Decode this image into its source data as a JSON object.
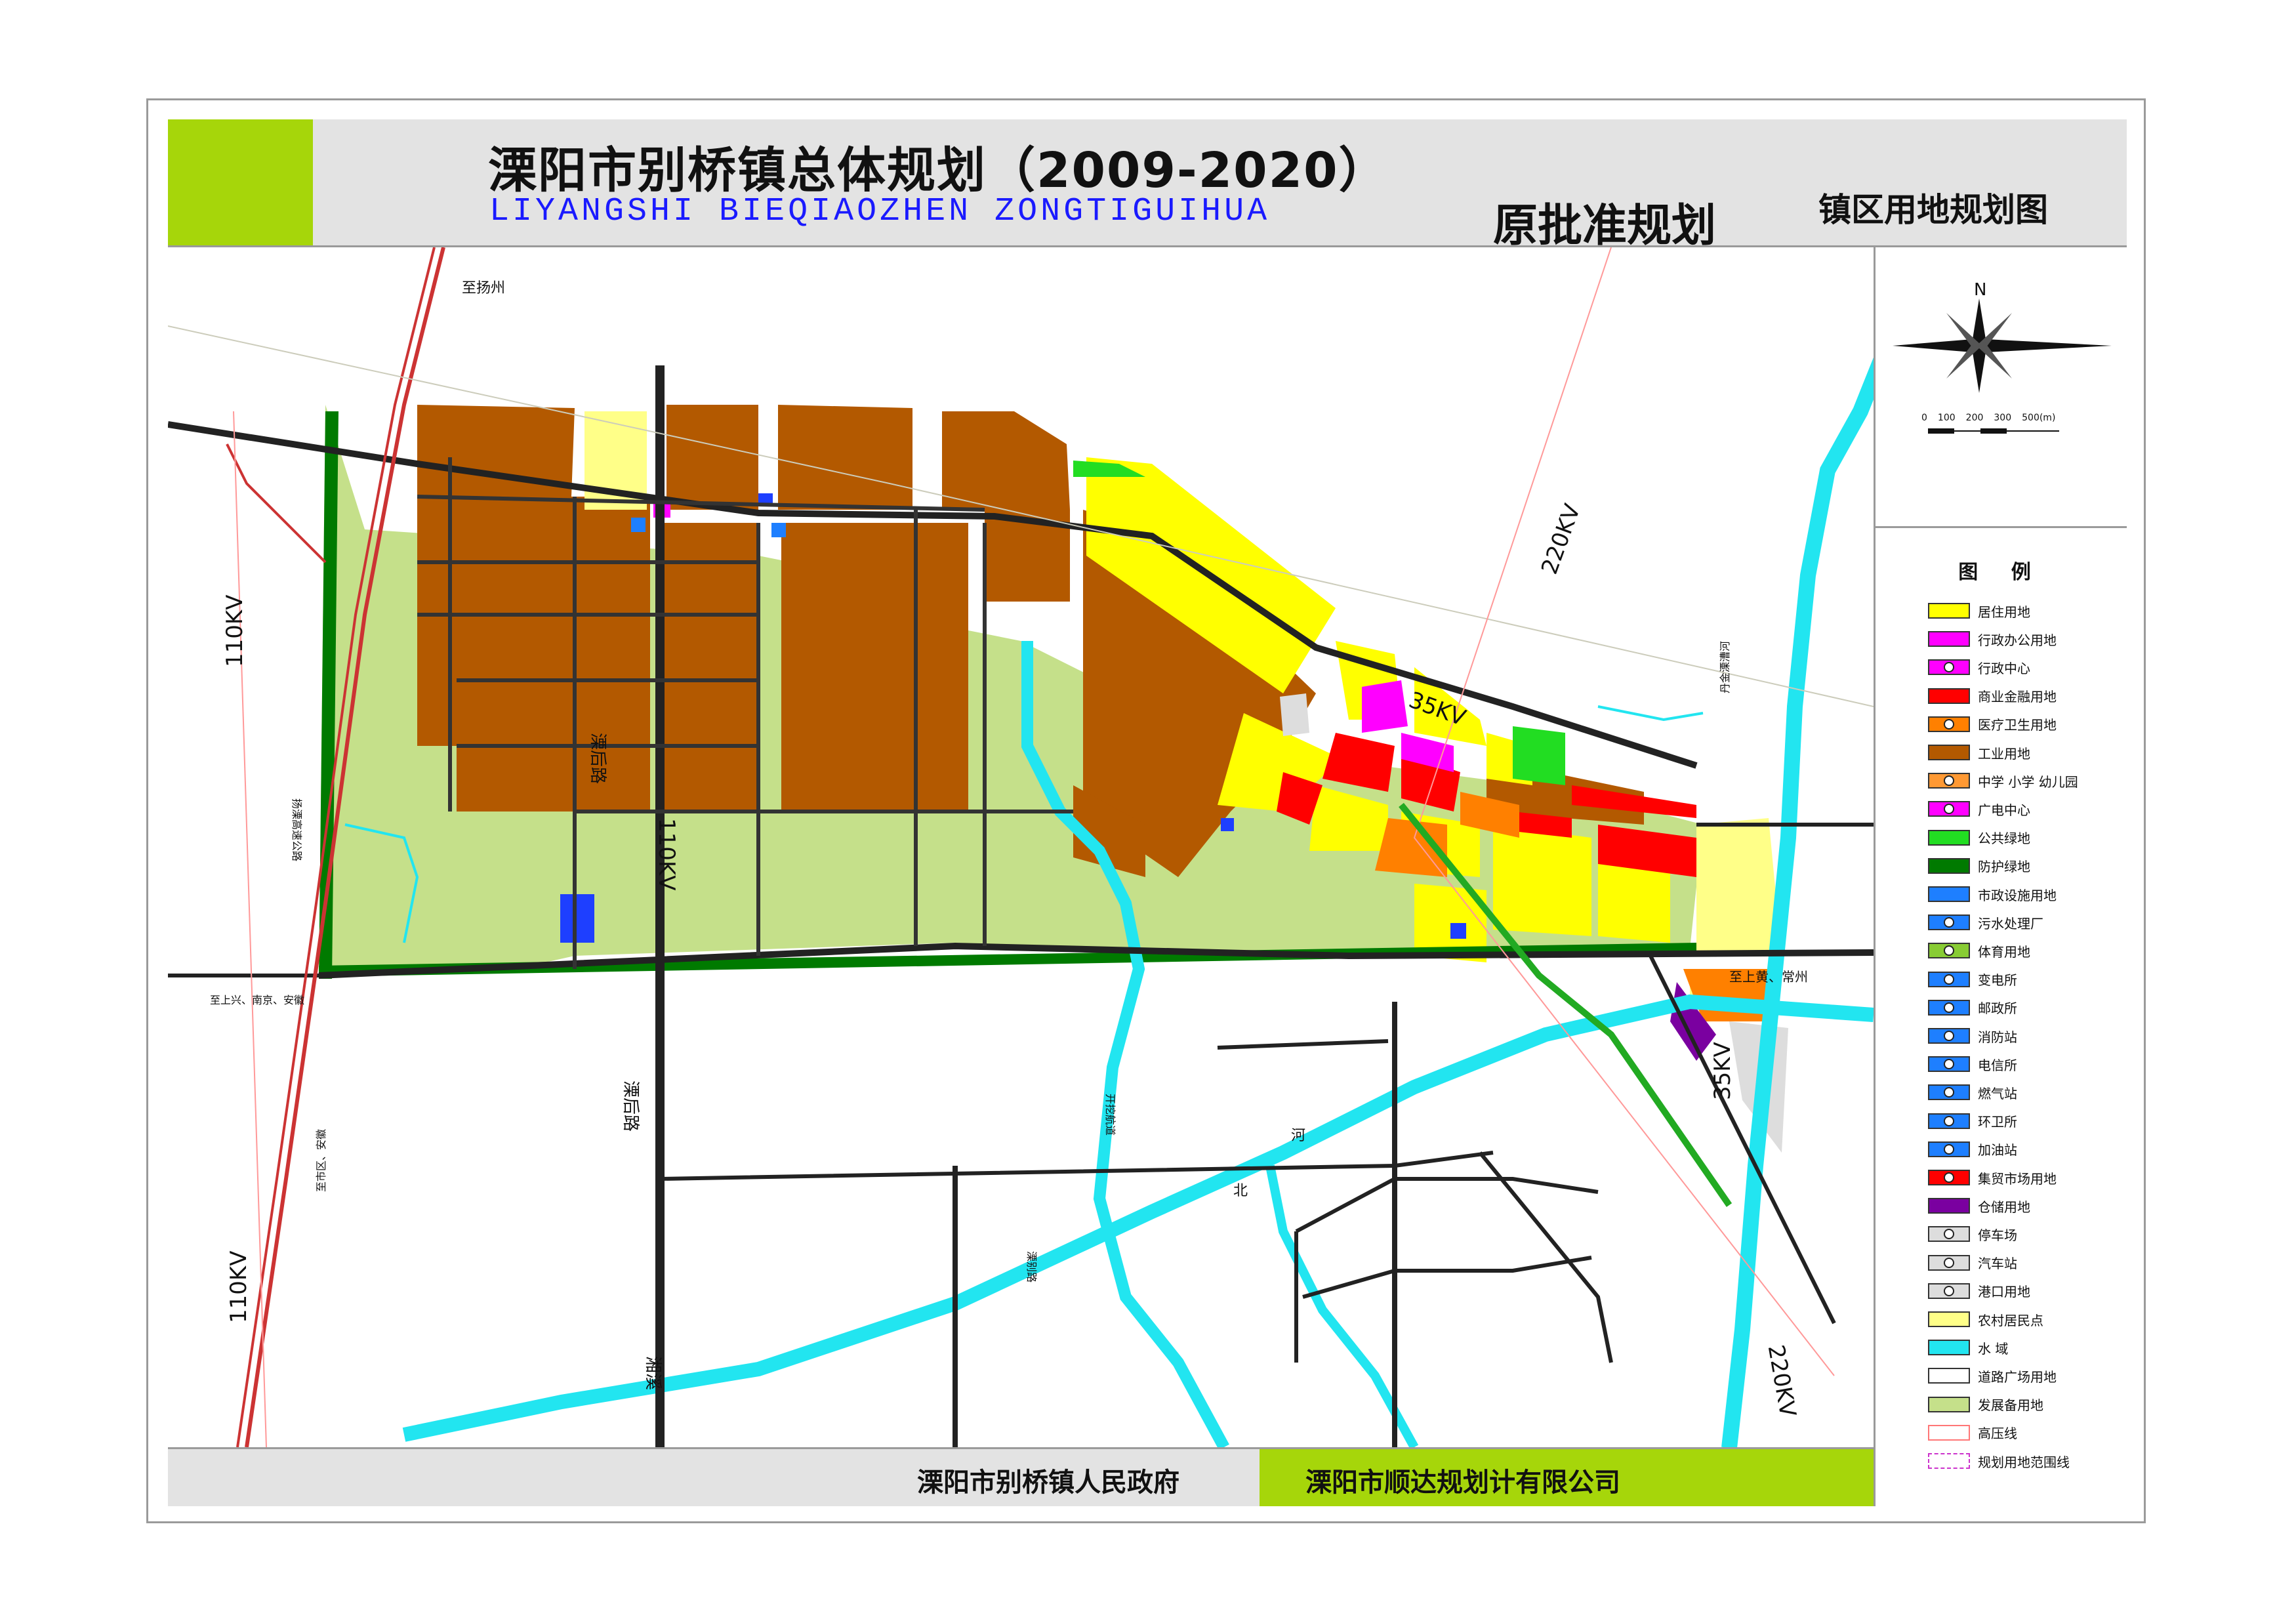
{
  "header": {
    "title": "溧阳市别桥镇总体规划（2009-2020）",
    "pinyin": "LIYANGSHI BIEQIAOZHEN ZONGTIGUIHUA",
    "original_plan": "原批准规划",
    "sheet_name": "镇区用地规划图"
  },
  "compass": {
    "north": "N",
    "scale_labels": [
      "0",
      "100",
      "200",
      "300",
      "500(m)"
    ]
  },
  "legend": {
    "title": "图 例",
    "items": [
      {
        "label": "居住用地",
        "color": "#ffff00"
      },
      {
        "label": "行政办公用地",
        "color": "#ff00ff"
      },
      {
        "label": "行政中心",
        "color": "#ff00ff"
      },
      {
        "label": "商业金融用地",
        "color": "#ff0000"
      },
      {
        "label": "医疗卫生用地",
        "color": "#ff8000"
      },
      {
        "label": "工业用地",
        "color": "#b35900"
      },
      {
        "label": "中学 小学 幼儿园",
        "color": "#ff9933"
      },
      {
        "label": "广电中心",
        "color": "#ff00ff"
      },
      {
        "label": "公共绿地",
        "color": "#22dd22"
      },
      {
        "label": "防护绿地",
        "color": "#007a00"
      },
      {
        "label": "市政设施用地",
        "color": "#1e7fff"
      },
      {
        "label": "污水处理厂",
        "color": "#1e7fff"
      },
      {
        "label": "体育用地",
        "color": "#88cc33"
      },
      {
        "label": "变电所",
        "color": "#1e7fff"
      },
      {
        "label": "邮政所",
        "color": "#1e7fff"
      },
      {
        "label": "消防站",
        "color": "#1e7fff"
      },
      {
        "label": "电信所",
        "color": "#1e7fff"
      },
      {
        "label": "燃气站",
        "color": "#1e7fff"
      },
      {
        "label": "环卫所",
        "color": "#1e7fff"
      },
      {
        "label": "加油站",
        "color": "#1e7fff"
      },
      {
        "label": "集贸市场用地",
        "color": "#ff0000"
      },
      {
        "label": "仓储用地",
        "color": "#7a00a0"
      },
      {
        "label": "停车场",
        "color": "#dddddd"
      },
      {
        "label": "汽车站",
        "color": "#dddddd"
      },
      {
        "label": "港口用地",
        "color": "#dddddd"
      },
      {
        "label": "农村居民点",
        "color": "#ffff88"
      },
      {
        "label": "水 域",
        "color": "#22e5f0"
      },
      {
        "label": "道路广场用地",
        "color": "#ffffff"
      },
      {
        "label": "发展备用地",
        "color": "#c5e08a"
      },
      {
        "label": "高压线",
        "color": "#ff7777"
      },
      {
        "label": "规划用地范围线",
        "color": "#cc33cc"
      }
    ]
  },
  "map_labels": {
    "to_yangzhou": "至扬州",
    "to_shangxing": "至上兴、南京、安徽",
    "to_shanghuang": "至上黄、常州",
    "to_liyang": "至市区、安徽",
    "road_lihou_1": "溧后路",
    "road_lihou_2": "溧后路",
    "road_yangli": "扬溧高速公路",
    "river_kaiwa": "开挖航道",
    "river_danjin": "丹金溧漕河",
    "river_north_1": "北",
    "river_north_2": "河",
    "road_libie": "溧别路",
    "road_xiang": "湘溪",
    "kv_110_a": "110KV",
    "kv_110_b": "110KV",
    "kv_110_c": "110KV",
    "kv_220_a": "220KV",
    "kv_220_b": "220KV",
    "kv_35_a": "35KV",
    "kv_35_b": "35KV"
  },
  "footer": {
    "government": "溧阳市别桥镇人民政府",
    "company": "溧阳市顺达规划计有限公司"
  }
}
